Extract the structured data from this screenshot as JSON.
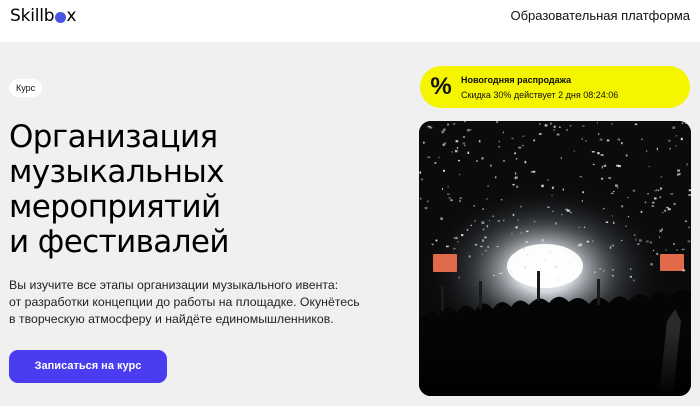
{
  "header": {
    "logo_text_pre": "Skillb",
    "logo_text_post": "x",
    "platform_link": "Образовательная платформа"
  },
  "hero": {
    "badge": "Курс",
    "title_lines": [
      "Организация",
      "музыкальных",
      "мероприятий",
      "и фестивалей"
    ],
    "description_lines": [
      "Вы изучите все этапы организации музыкального ивента:",
      "от разработки концепции до работы на площадке. Окунётесь",
      "в творческую атмосферу и найдёте единомышленников."
    ],
    "cta_label": "Записаться на курс"
  },
  "promo": {
    "icon": "percent-icon",
    "icon_glyph": "%",
    "title": "Новогодняя распродажа",
    "text": "Скидка 30% действует 2 дня 08:24:06"
  },
  "image": {
    "subject": "concert-crowd-photo"
  },
  "colors": {
    "accent": "#4a3cf0",
    "promo_bg": "#f5f500",
    "page_bg": "#f0f0f0"
  }
}
